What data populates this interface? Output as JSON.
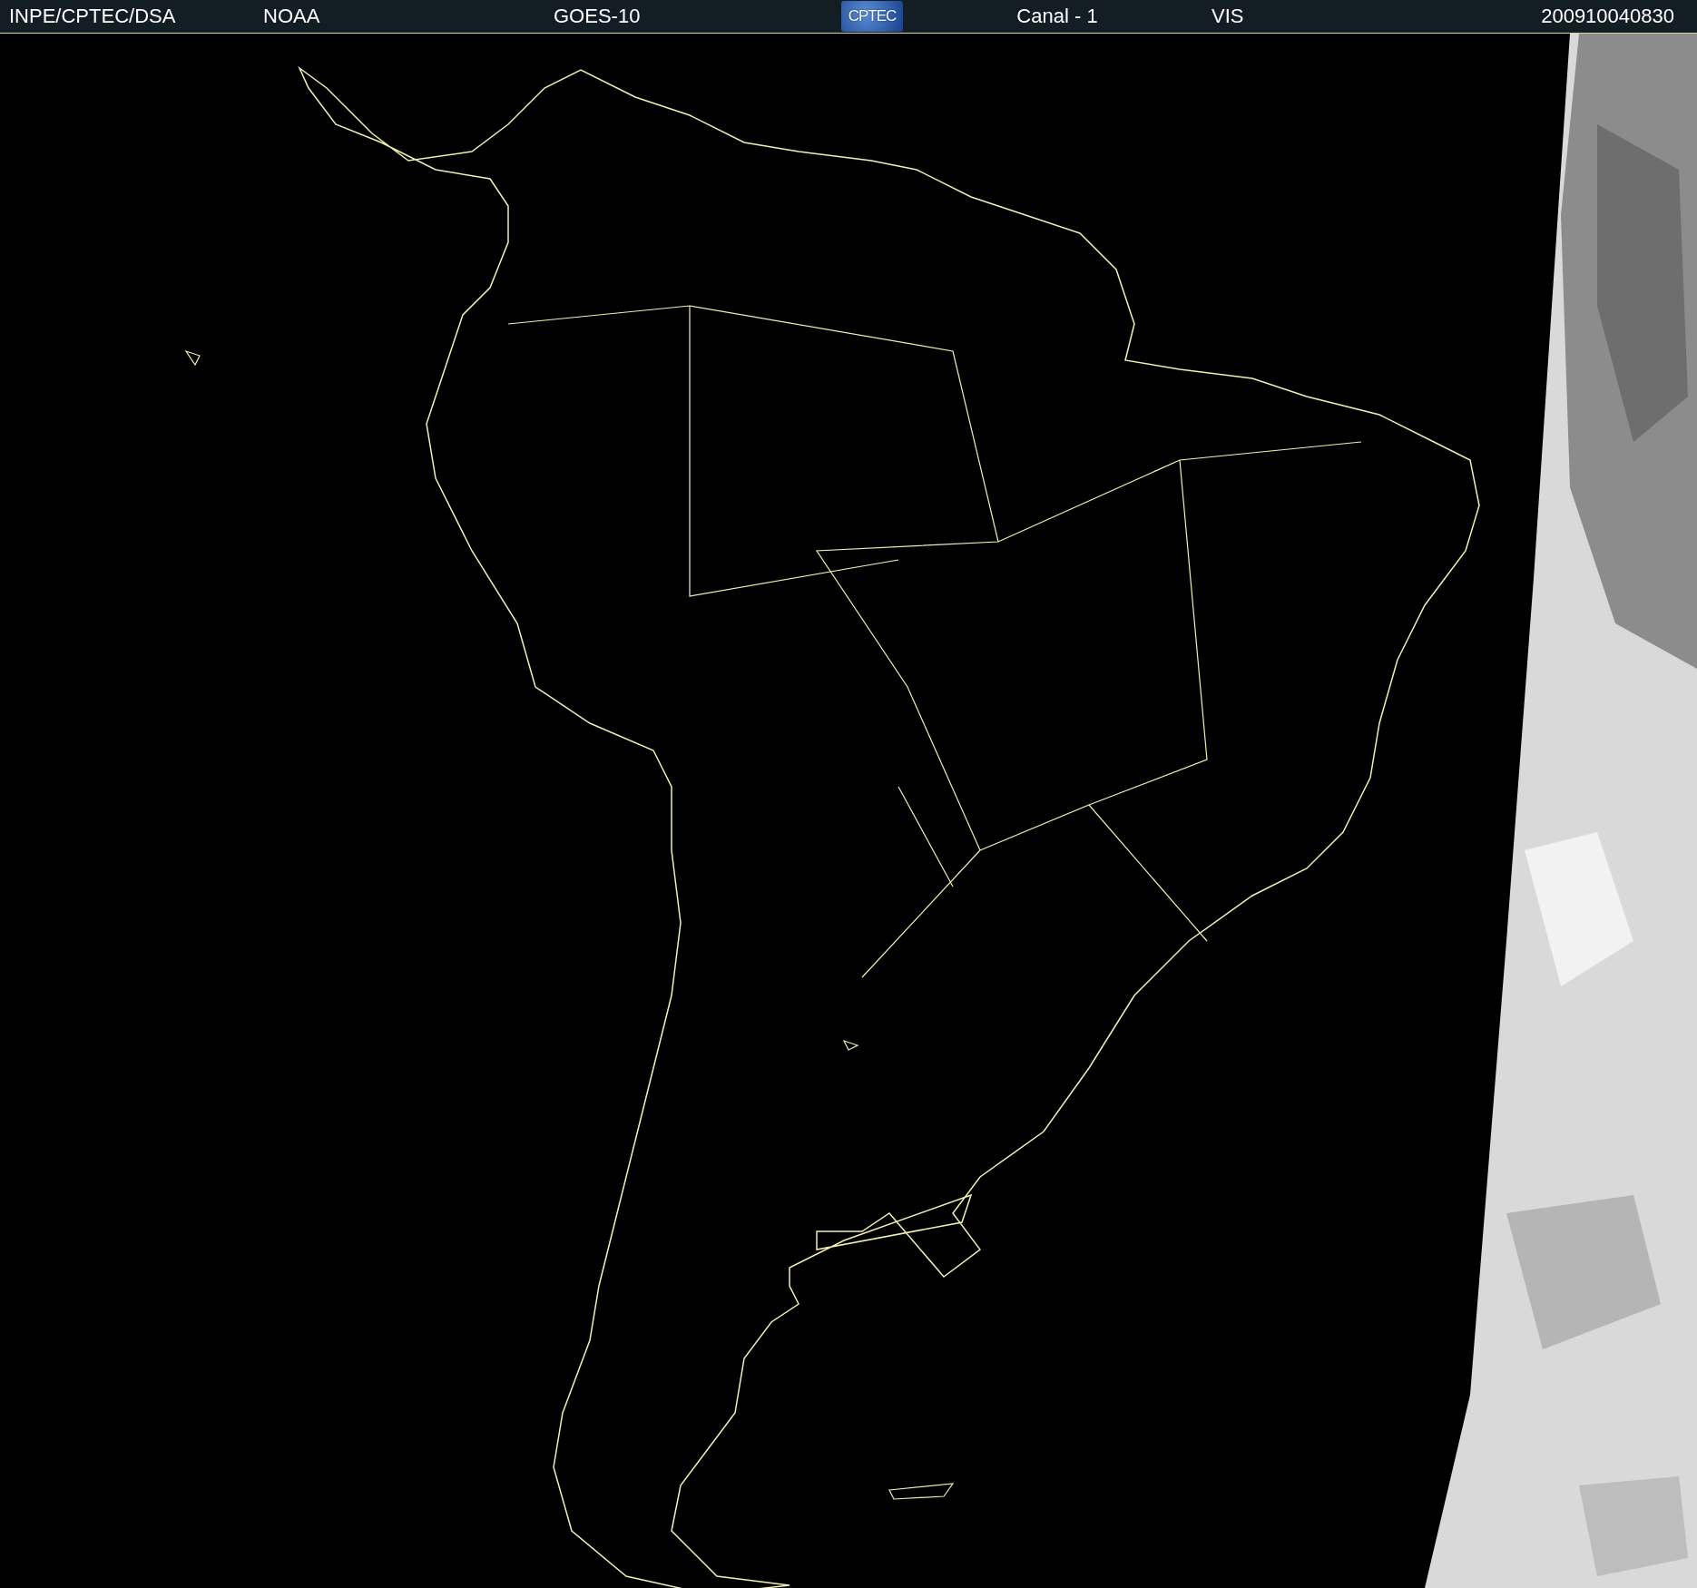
{
  "header": {
    "agency": "INPE/CPTEC/DSA",
    "source": "NOAA",
    "satellite": "GOES-10",
    "logo": "CPTEC",
    "channel": "Canal - 1",
    "band": "VIS",
    "timestamp": "200910040830"
  }
}
